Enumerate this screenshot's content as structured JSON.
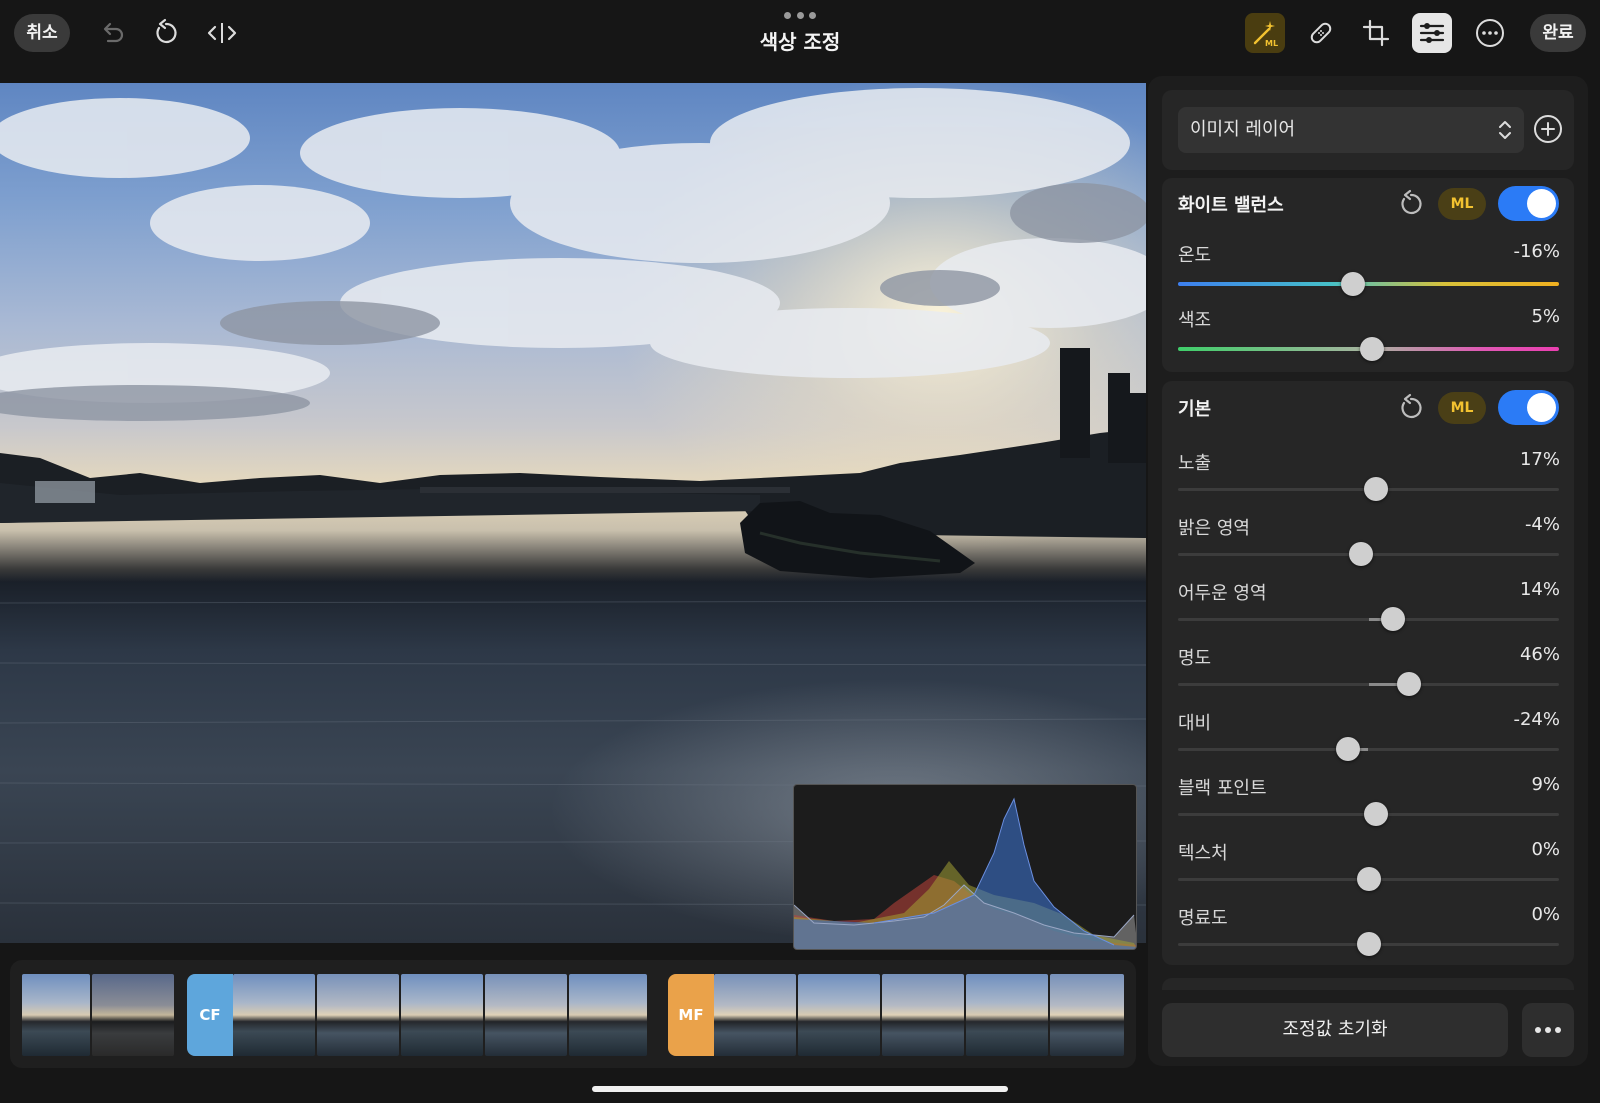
{
  "toolbar": {
    "cancel_label": "취소",
    "title": "색상 조정",
    "done_label": "완료",
    "icons": [
      "undo-icon",
      "revert-icon",
      "compare-icon",
      "ml-magic-wand-icon",
      "healing-bandage-icon",
      "crop-icon",
      "adjust-sliders-icon",
      "more-icon"
    ],
    "accent_active": "#f2c230"
  },
  "layer": {
    "label": "이미지 레이어"
  },
  "white_balance": {
    "title": "화이트 밸런스",
    "ml_label": "ML",
    "enabled": true,
    "sliders": [
      {
        "label": "온도",
        "value": "-16%",
        "position": 0.46
      },
      {
        "label": "색조",
        "value": "5%",
        "position": 0.51
      }
    ]
  },
  "basic": {
    "title": "기본",
    "ml_label": "ML",
    "enabled": true,
    "sliders": [
      {
        "label": "노출",
        "value": "17%",
        "position": 0.52
      },
      {
        "label": "밝은 영역",
        "value": "-4%",
        "position": 0.48
      },
      {
        "label": "어두운 영역",
        "value": "14%",
        "position": 0.565
      },
      {
        "label": "명도",
        "value": "46%",
        "position": 0.605
      },
      {
        "label": "대비",
        "value": "-24%",
        "position": 0.445
      },
      {
        "label": "블랙 포인트",
        "value": "9%",
        "position": 0.52
      },
      {
        "label": "텍스처",
        "value": "0%",
        "position": 0.5
      },
      {
        "label": "명료도",
        "value": "0%",
        "position": 0.5
      }
    ]
  },
  "footer": {
    "reset_label": "조정값 초기화"
  },
  "filmstrip": {
    "badges": [
      {
        "label": "CF",
        "color": "#5ea6dc"
      },
      {
        "label": "MF",
        "color": "#eaa24a"
      }
    ]
  },
  "toggle_color": "#2b7bf6"
}
